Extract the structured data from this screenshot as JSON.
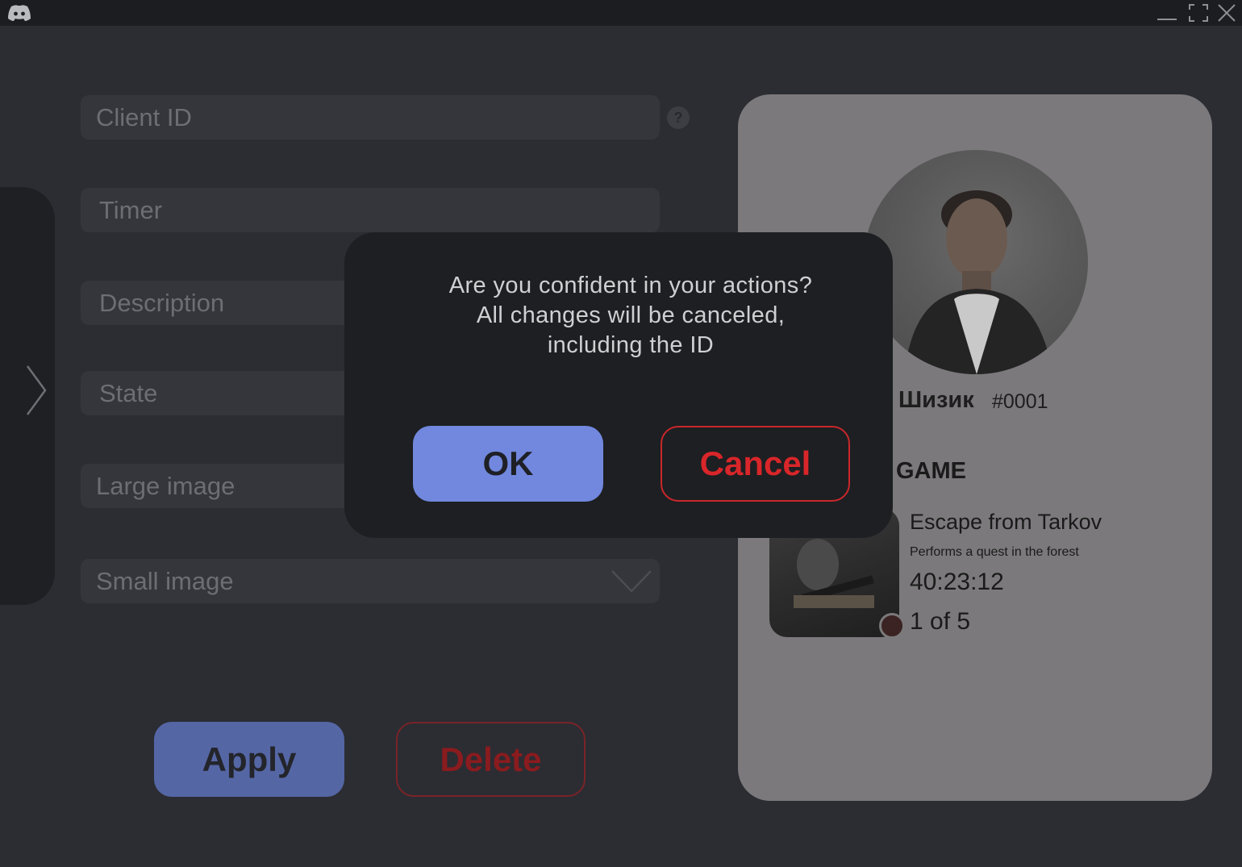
{
  "titlebar": {
    "logo_icon": "discord-logo-icon",
    "minimize_icon": "minimize-icon",
    "maximize_icon": "maximize-icon",
    "close_icon": "close-icon"
  },
  "sidebar": {
    "expand_icon": "chevron-right-icon"
  },
  "form": {
    "client_id_placeholder": "Client ID",
    "timer_placeholder": "Timer",
    "description_placeholder": "Description",
    "state_placeholder": "State",
    "large_image_placeholder": "Large image",
    "small_image_placeholder": "Small image",
    "help_icon": "help-icon",
    "dropdown_icon": "chevron-down-icon"
  },
  "actions": {
    "apply_label": "Apply",
    "delete_label": "Delete"
  },
  "preview": {
    "username": "Шизик",
    "tag": "#0001",
    "section_title": "GAME",
    "game_name": "Escape from Tarkov",
    "details": "Performs a quest in the forest",
    "timer": "40:23:12",
    "party": "1 of 5"
  },
  "dialog": {
    "message_line1": "Are you confident in your actions?",
    "message_line2": "All changes will be canceled,",
    "message_line3": "including the ID",
    "ok_label": "OK",
    "cancel_label": "Cancel"
  },
  "colors": {
    "background": "#2b2d33",
    "titlebar": "#1c1d20",
    "accent_blue": "#7288de",
    "accent_red": "#d8262a",
    "card": "#7b797b"
  }
}
